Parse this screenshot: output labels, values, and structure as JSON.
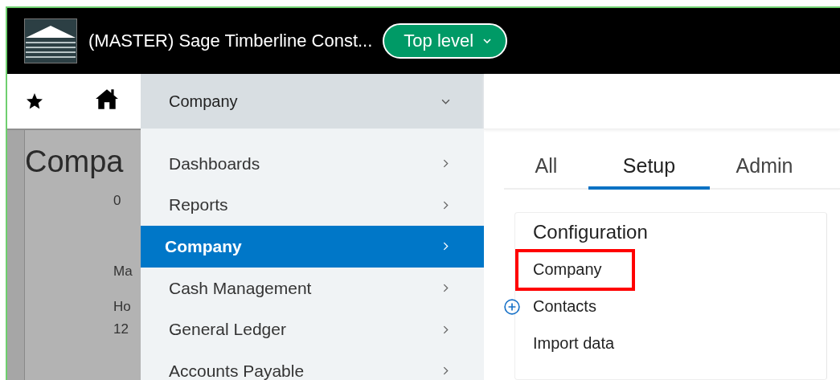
{
  "header": {
    "title": "(MASTER) Sage Timberline Const...",
    "level_button": "Top level"
  },
  "background_page": {
    "title": "Compa",
    "fields": [
      {
        "text": "0"
      },
      {
        "text": "Ma"
      },
      {
        "text": "Ho"
      },
      {
        "text": "12"
      }
    ]
  },
  "menu": {
    "current": "Company",
    "items": [
      {
        "label": "Dashboards",
        "selected": false
      },
      {
        "label": "Reports",
        "selected": false
      },
      {
        "label": "Company",
        "selected": true
      },
      {
        "label": "Cash Management",
        "selected": false
      },
      {
        "label": "General Ledger",
        "selected": false
      },
      {
        "label": "Accounts Payable",
        "selected": false
      }
    ]
  },
  "tabs": [
    {
      "label": "All",
      "selected": false
    },
    {
      "label": "Setup",
      "selected": true
    },
    {
      "label": "Admin",
      "selected": false
    }
  ],
  "section": {
    "heading": "Configuration",
    "links": [
      {
        "label": "Company",
        "highlighted": true,
        "kind": "plain"
      },
      {
        "label": "Contacts",
        "highlighted": false,
        "kind": "add"
      },
      {
        "label": "Import data",
        "highlighted": false,
        "kind": "plain"
      }
    ]
  }
}
